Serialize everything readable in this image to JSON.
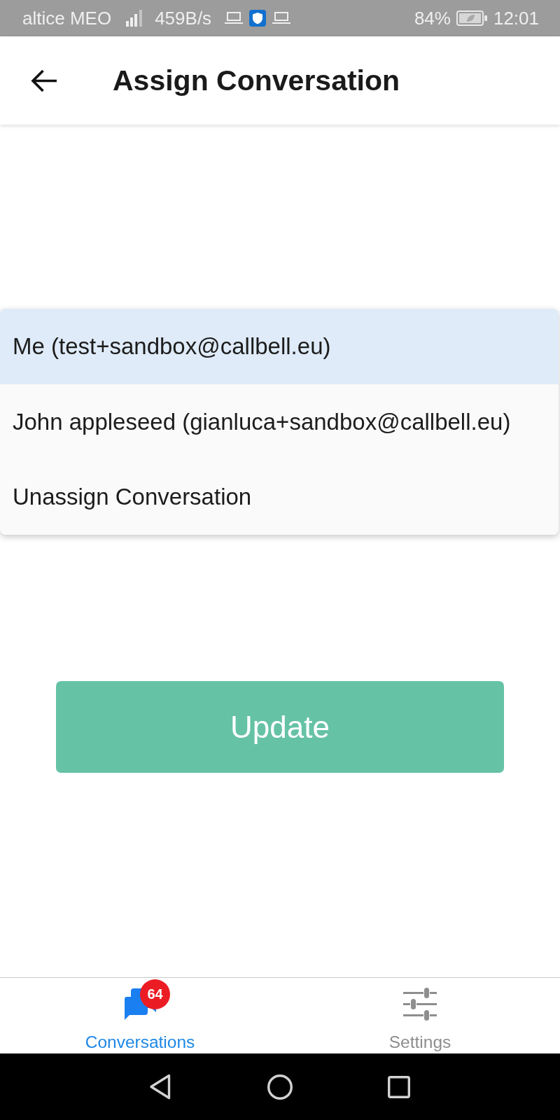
{
  "status_bar": {
    "carrier": "altice MEO",
    "speed": "459B/s",
    "battery": "84%",
    "time": "12:01"
  },
  "header": {
    "title": "Assign Conversation"
  },
  "menu": {
    "items": [
      {
        "label": "Me (test+sandbox@callbell.eu)",
        "selected": true
      },
      {
        "label": "John appleseed (gianluca+sandbox@callbell.eu)",
        "selected": false
      },
      {
        "label": "Unassign Conversation",
        "selected": false
      }
    ]
  },
  "update_button": {
    "label": "Update"
  },
  "bottom_nav": {
    "tabs": [
      {
        "kind": "conversations",
        "label": "Conversations",
        "selected": true,
        "badge": "64"
      },
      {
        "kind": "settings",
        "label": "Settings",
        "selected": false
      }
    ]
  }
}
